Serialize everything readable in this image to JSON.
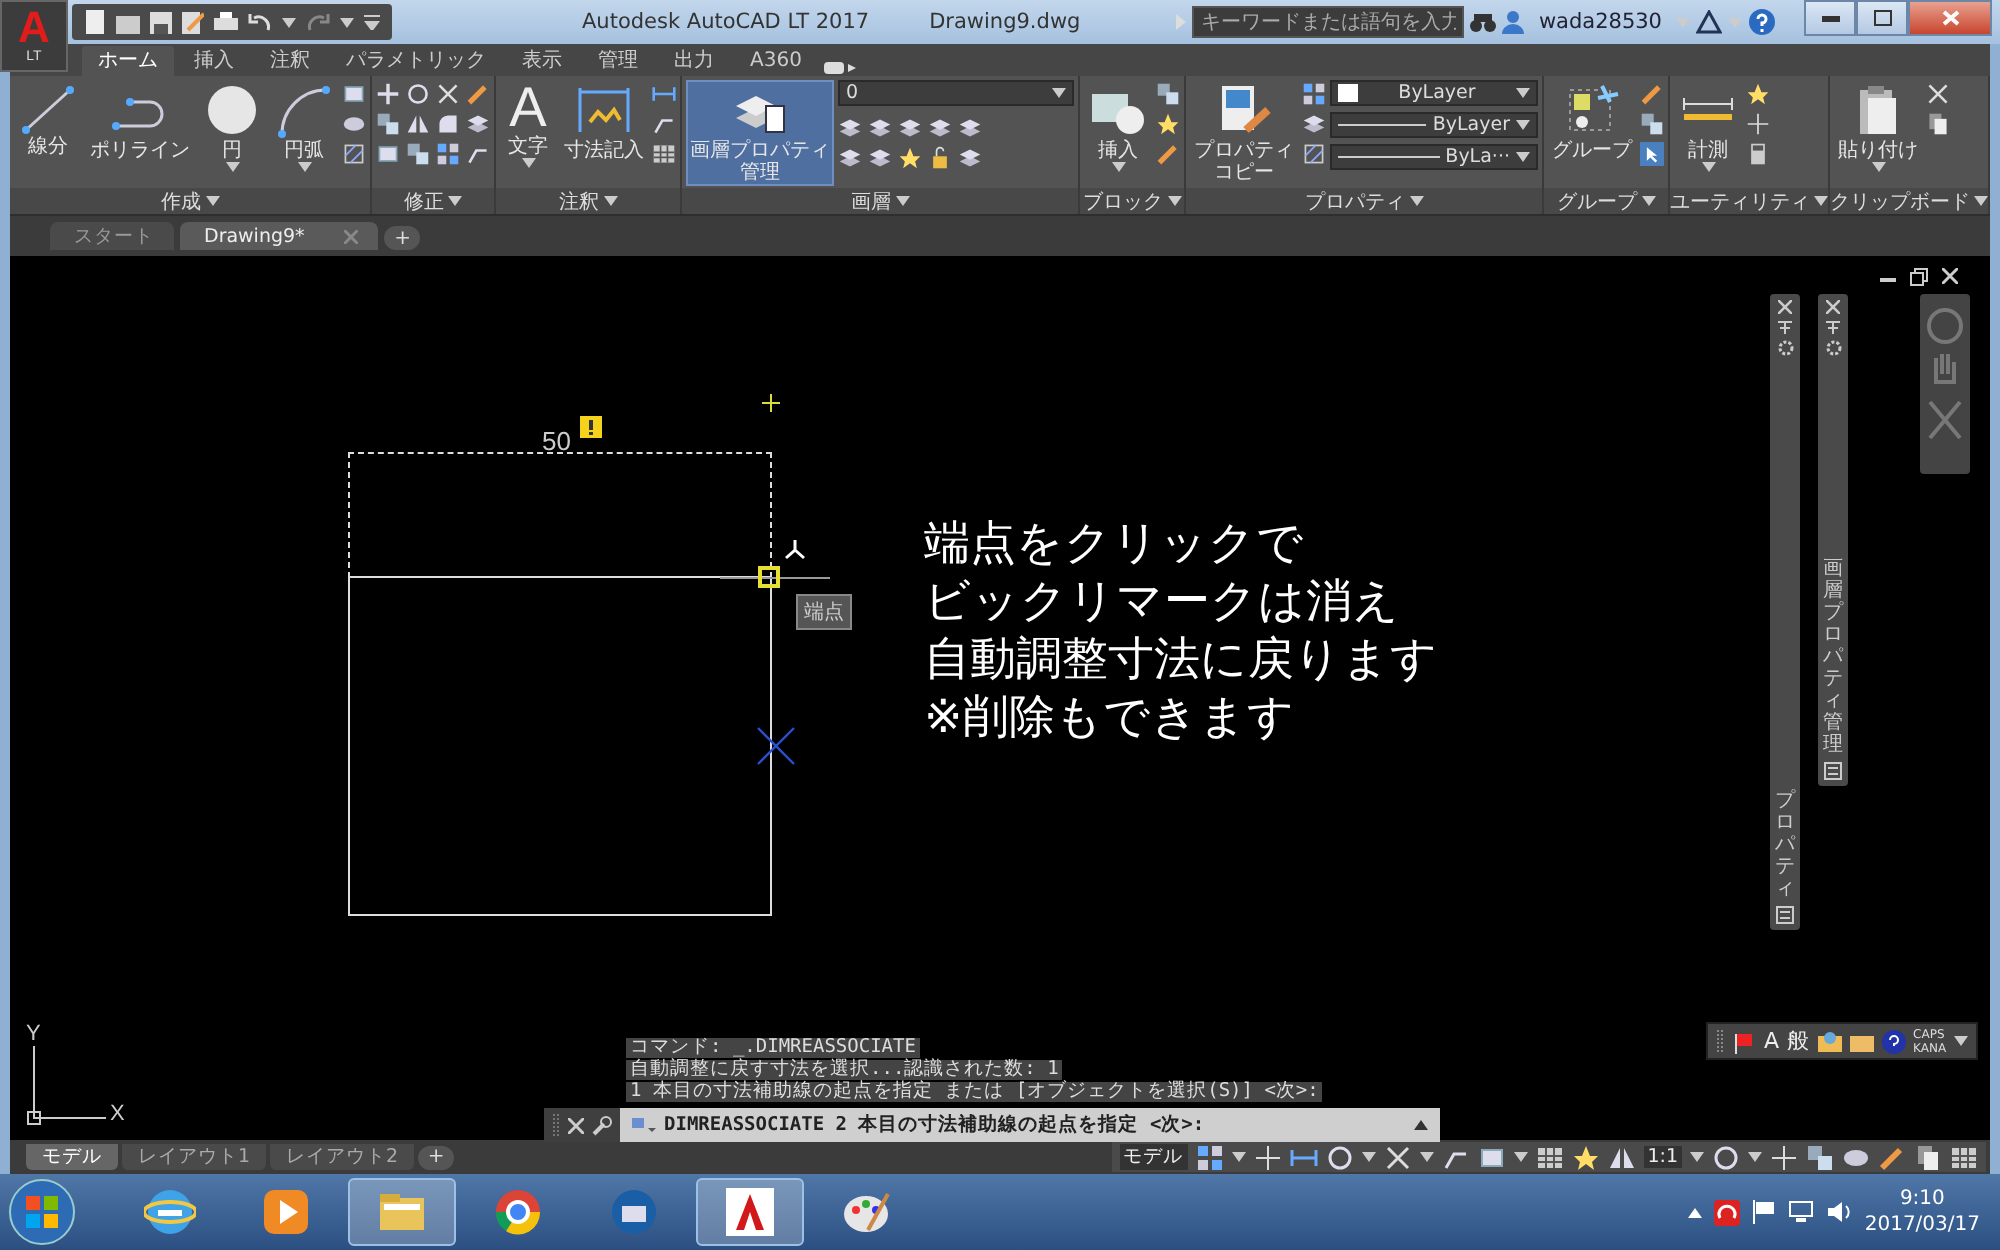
{
  "window": {
    "app_button": "A",
    "app_edition": "LT",
    "title": "Autodesk AutoCAD LT 2017",
    "document": "Drawing9.dwg"
  },
  "search": {
    "placeholder": "キーワードまたは語句を入力"
  },
  "user": {
    "name": "wada28530"
  },
  "ribbon_tabs": [
    {
      "label": "ホーム",
      "selected": true
    },
    {
      "label": "挿入",
      "selected": false
    },
    {
      "label": "注釈",
      "selected": false
    },
    {
      "label": "パラメトリック",
      "selected": false
    },
    {
      "label": "表示",
      "selected": false
    },
    {
      "label": "管理",
      "selected": false
    },
    {
      "label": "出力",
      "selected": false
    },
    {
      "label": "A360",
      "selected": false
    }
  ],
  "ribbon_panels": [
    {
      "title": "作成",
      "tools": [
        {
          "label": "線分",
          "dropdown": false,
          "active": false
        },
        {
          "label": "ポリライン",
          "dropdown": false,
          "active": false
        },
        {
          "label": "円",
          "dropdown": true,
          "active": false
        },
        {
          "label": "円弧",
          "dropdown": true,
          "active": false
        }
      ]
    },
    {
      "title": "修正"
    },
    {
      "title": "注釈",
      "tools": [
        {
          "glyph": "A",
          "label": "文字",
          "dropdown": true,
          "active": false
        },
        {
          "label": "寸法記入",
          "dropdown": false,
          "active": false
        }
      ]
    },
    {
      "title": "画層",
      "tools": [
        {
          "label": "画層プロパティ",
          "label_line_2": "管理",
          "dropdown": false,
          "active": true
        }
      ],
      "dropdowns": [
        {
          "kind": "layer",
          "value": "0"
        }
      ]
    },
    {
      "title": "ブロック",
      "tools": [
        {
          "label": "挿入",
          "dropdown": true,
          "active": false
        }
      ]
    },
    {
      "title": "プロパティ",
      "tools": [
        {
          "label": "プロパティ",
          "label_line_2": "コピー",
          "dropdown": false,
          "active": false
        }
      ],
      "dropdowns": [
        {
          "kind": "color",
          "value": "ByLayer"
        },
        {
          "kind": "linetype",
          "value": "ByLayer"
        },
        {
          "kind": "lineweight",
          "value": "ByLa···"
        }
      ]
    },
    {
      "title": "グループ",
      "tools": [
        {
          "label": "グループ",
          "dropdown": false,
          "active": false
        }
      ]
    },
    {
      "title": "ユーティリティ",
      "tools": [
        {
          "label": "計測",
          "dropdown": true,
          "active": false
        }
      ]
    },
    {
      "title": "クリップボード",
      "tools": [
        {
          "label": "貼り付け",
          "dropdown": true,
          "active": false
        }
      ]
    }
  ],
  "file_tabs": {
    "tabs": [
      {
        "label": "スタート",
        "selected": false
      },
      {
        "label": "Drawing9*",
        "selected": true
      }
    ],
    "add": "+"
  },
  "drawing": {
    "dimension": "50",
    "snap_tooltip": "端点"
  },
  "annotation": [
    "端点をクリックで",
    "ビックリマークは消え",
    "自動調整寸法に戻ります",
    "※削除もできます"
  ],
  "palettes": [
    {
      "title": "プロパティ"
    },
    {
      "title": "画層プロパティ管理"
    }
  ],
  "command_history": [
    "コマンド: _.DIMREASSOCIATE",
    "自動調整に戻す寸法を選択...認識された数: 1",
    "1 本目の寸法補助線の起点を指定 または [オブジェクトを選択(S)] <次>:"
  ],
  "command_line": {
    "value": "DIMREASSOCIATE 2 本目の寸法補助線の起点を指定 <次>:"
  },
  "ucs": {
    "y": "Y",
    "x": "X"
  },
  "tray_widget": {
    "ime": "A",
    "mode": "般",
    "caps": "CAPS",
    "kana": "KANA"
  },
  "layout_tabs": {
    "tabs": [
      {
        "label": "モデル",
        "selected": true
      },
      {
        "label": "レイアウト1",
        "selected": false
      },
      {
        "label": "レイアウト2",
        "selected": false
      }
    ],
    "add": "+"
  },
  "status_bar": {
    "space": "モデル",
    "scale": "1:1"
  },
  "taskbar": {
    "apps": [
      {
        "kind": "browser-e",
        "running": false
      },
      {
        "kind": "media",
        "running": false
      },
      {
        "kind": "folder",
        "running": true
      },
      {
        "kind": "browser-ring",
        "running": false
      },
      {
        "kind": "mail",
        "running": false
      },
      {
        "kind": "cad",
        "running": true
      },
      {
        "kind": "paint",
        "running": false
      }
    ]
  },
  "clock": {
    "time": "9:10",
    "date": "2017/03/17"
  }
}
